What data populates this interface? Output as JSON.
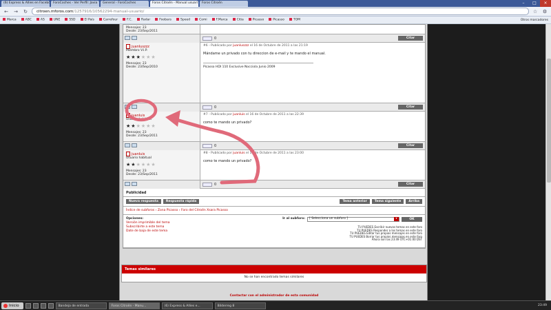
{
  "browser": {
    "tabs": [
      {
        "label": "(6) Express & Allies en Faceboo"
      },
      {
        "label": "ForoCoches - Ver Perfil: Javia"
      },
      {
        "label": "General - ForoCoches"
      },
      {
        "label": "Foros Citroën - Manual usuari"
      },
      {
        "label": "Foros Citroën"
      }
    ],
    "url_domain": "citroen.mforos.com",
    "url_path": "/1257916/10562294-manual-usuario/",
    "bookmarks": [
      "Marca",
      "ABC",
      "AS",
      "UNE",
      "SSD",
      "El País",
      "Carrefour",
      "F.C.",
      "Radar",
      "Foobars",
      "Speed",
      "Comi",
      "F.Marca",
      "Citia",
      "Picasso",
      "Picasso",
      "TOM"
    ],
    "other_bookmarks": "Otros marcadores"
  },
  "posts": [
    {
      "author": "",
      "rank": "",
      "stars_on": 0,
      "messages": "Mensajes: 23",
      "since": "Desde: 23/Sep/2011",
      "header": "",
      "message": "",
      "signature": "",
      "partial": true
    },
    {
      "author": "juanluszzz",
      "rank": "Miembro V.I.P.",
      "stars_on": 3,
      "messages": "Mensajes: 23",
      "since": "Desde: 23/Sep/2010",
      "header_num": "#6 -",
      "header_pre": "Publicado por",
      "header_author": "juanluszzz",
      "header_date": "el 16 de Octubre de 2011 a las 21:19",
      "message": "Mándame un privado con tu direccion de e-mail y te mando el manual.",
      "signature": "Picasso HDI 110 Exclusive Nocciola Junio 2009",
      "has_avatar": true
    },
    {
      "author": "juanluis",
      "rank": "Usuario habitual",
      "stars_on": 2,
      "messages": "Mensajes: 23",
      "since": "Desde: 23/Sep/2011",
      "header_num": "#7 -",
      "header_pre": "Publicado por",
      "header_author": "juanluis",
      "header_date": "el 16 de Octubre de 2011 a las 22:39",
      "message": "como te mando un privado?",
      "signature": ""
    },
    {
      "author": "juanluis",
      "rank": "Usuario habitual",
      "stars_on": 2,
      "messages": "Mensajes: 23",
      "since": "Desde: 23/Sep/2011",
      "header_num": "#8 -",
      "header_pre": "Publicado por",
      "header_author": "juanluis",
      "header_date": "el 16 de Octubre de 2011 a las 23:00",
      "message": "como te mando un privado?",
      "signature": ""
    }
  ],
  "post_buttons": {
    "vote_count": "0",
    "quote": "Citar"
  },
  "forum": {
    "publicidad": "Publicidad",
    "new_reply": "Nueva respuesta",
    "quick_reply": "Respuesta rápida",
    "prev_topic": "Tema anterior",
    "next_topic": "Tema siguiente",
    "top": "Arriba",
    "breadcrumb": "Índice de subforos › Zona Picasso › Foro del Citroën Xsara Picasso",
    "options_title": "Opciones:",
    "options": [
      "Versión imprimible del tema",
      "Subscribirte a este tema",
      "Date de baja de este tema"
    ],
    "goto_label": "Ir al subforo:",
    "goto_value": "[ Selecciona un subforo ]",
    "ok": "OK",
    "rules": [
      "TU PUEDES Escribir nuevos temas en este foro",
      "TU PUEDES Responder a los temas en este foro",
      "TU PUEDES Editar tus propios mensajes en este foro",
      "TU PUEDES Borrar tus propios mensajes en este foro"
    ],
    "time": "Ahora son las 23:49 UTC+01:00 DST",
    "similar_title": "Temas similares",
    "similar_empty": "No se han encontrado temas similares",
    "contact": "Contactar con el administrador de esta comunidad"
  },
  "taskbar": {
    "start": "Inicio",
    "items": [
      "Bandeja de entrada",
      "Foros Citroën - Manu...",
      "(6) Express & Allies e...",
      "Bilderreg 8"
    ],
    "clock": "23:49"
  }
}
